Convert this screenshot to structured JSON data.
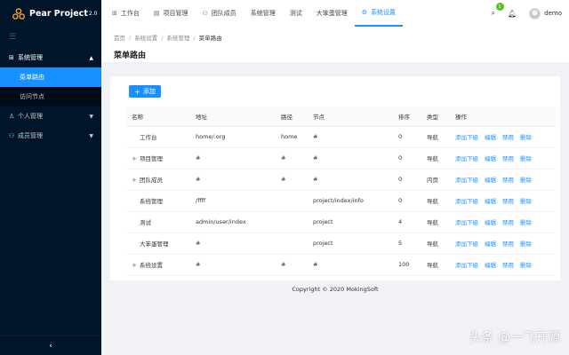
{
  "app": {
    "name": "Pear Project",
    "version": "2.0"
  },
  "sidebar": {
    "collapse_icon": "☰",
    "menu": [
      {
        "label": "系统管理",
        "icon": "settings",
        "expanded": true,
        "children": [
          {
            "label": "菜单路由",
            "active": true
          },
          {
            "label": "访问节点",
            "active": false
          }
        ]
      },
      {
        "label": "个人管理",
        "icon": "user"
      },
      {
        "label": "成员管理",
        "icon": "team"
      }
    ],
    "footer_icon": "‹"
  },
  "topnav": {
    "items": [
      {
        "label": "工作台",
        "icon": "dashboard-icon"
      },
      {
        "label": "项目管理",
        "icon": "project-icon"
      },
      {
        "label": "团队成员",
        "icon": "team-icon"
      },
      {
        "label": "系统管理",
        "icon": ""
      },
      {
        "label": "测试",
        "icon": ""
      },
      {
        "label": "大笨蛋管理",
        "icon": ""
      },
      {
        "label": "系统设置",
        "icon": "gear-icon",
        "active": true
      }
    ],
    "notification_count": "1",
    "username": "demo"
  },
  "breadcrumb": [
    "首页",
    "系统设置",
    "系统管理",
    "菜单路由"
  ],
  "page_title": "菜单路由",
  "add_button": "添加",
  "table": {
    "columns": [
      "名称",
      "地址",
      "路径",
      "节点",
      "排序",
      "类型",
      "操作"
    ],
    "rows": [
      {
        "expandable": false,
        "name": "工作台",
        "address": "home/:org",
        "path": "home",
        "node": "#",
        "order": "0",
        "type": "导航"
      },
      {
        "expandable": true,
        "name": "项目管理",
        "address": "#",
        "path": "#",
        "node": "#",
        "order": "0",
        "type": "导航"
      },
      {
        "expandable": true,
        "name": "团队成员",
        "address": "#",
        "path": "#",
        "node": "#",
        "order": "0",
        "type": "内页"
      },
      {
        "expandable": false,
        "name": "系统管理",
        "address": "/ffff",
        "path": "",
        "node": "project/index/info",
        "order": "0",
        "type": "导航"
      },
      {
        "expandable": false,
        "name": "测试",
        "address": "admin/user/index",
        "path": "",
        "node": "project",
        "order": "4",
        "type": "导航"
      },
      {
        "expandable": false,
        "name": "大笨蛋管理",
        "address": "#",
        "path": "",
        "node": "project",
        "order": "5",
        "type": "导航"
      },
      {
        "expandable": true,
        "name": "系统设置",
        "address": "#",
        "path": "#",
        "node": "#",
        "order": "100",
        "type": "导航"
      }
    ],
    "actions": [
      "添加下级",
      "编辑",
      "禁用",
      "删除"
    ]
  },
  "footer": "Copyright © 2020 MokingSoft",
  "watermark": "头条 @一飞开源",
  "colors": {
    "accent": "#1890ff",
    "sidebar_bg": "#001529",
    "badge": "#52c41a"
  }
}
